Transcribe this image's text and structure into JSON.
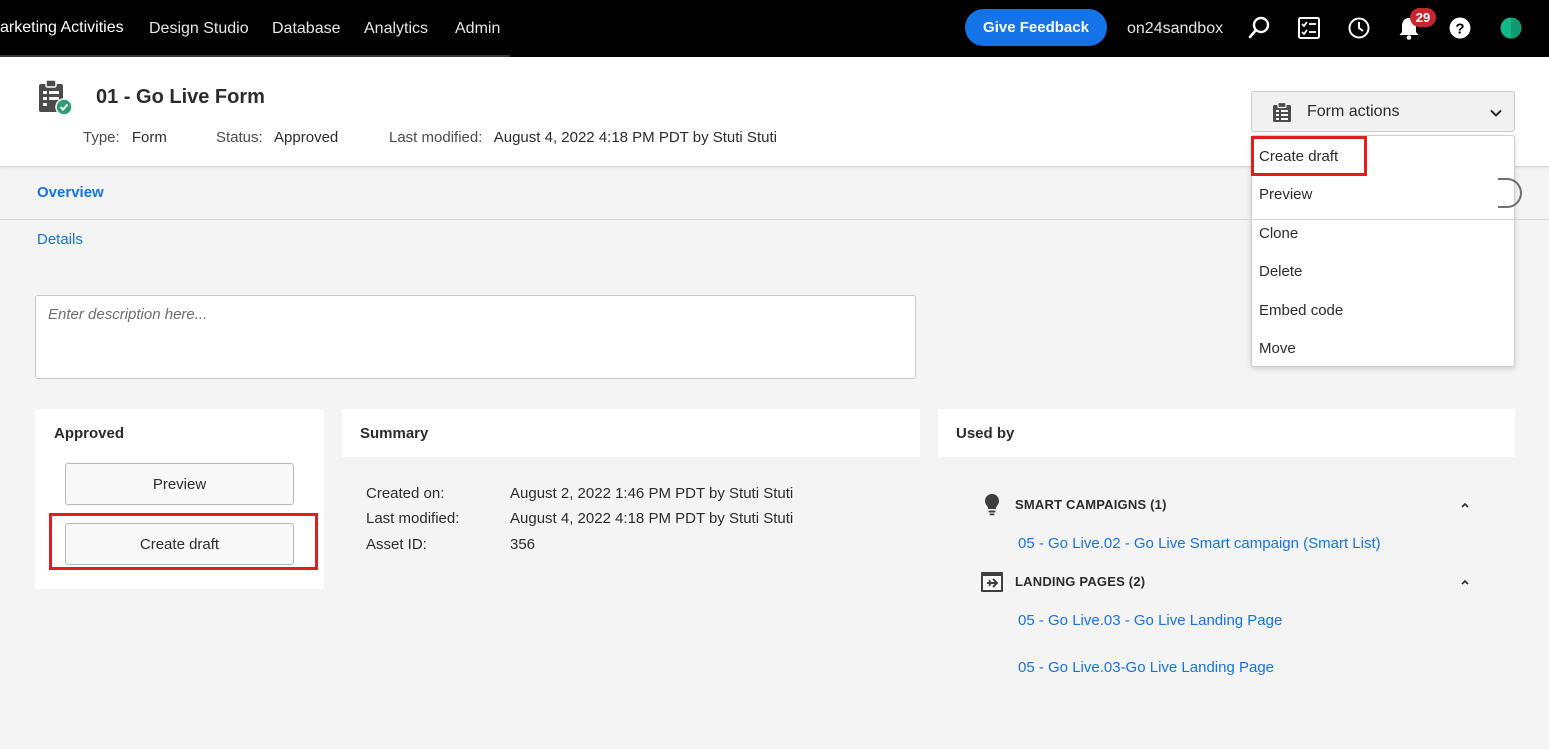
{
  "topnav": {
    "items": [
      {
        "label": "arketing Activities",
        "active": true
      },
      {
        "label": "Design Studio",
        "active": false
      },
      {
        "label": "Database",
        "active": false
      },
      {
        "label": "Analytics",
        "active": false
      },
      {
        "label": "Admin",
        "active": false
      }
    ],
    "feedback_label": "Give Feedback",
    "sandbox": "on24sandbox",
    "notification_count": "29",
    "icons": [
      "search-icon",
      "tasks-icon",
      "history-icon",
      "bell-icon",
      "help-icon",
      "user-avatar-icon"
    ]
  },
  "header": {
    "title": "01 - Go Live Form",
    "type_label": "Type:",
    "type_value": "Form",
    "status_label": "Status:",
    "status_value": "Approved",
    "modified_label": "Last modified:",
    "modified_value": "August 4, 2022 4:18 PM PDT by Stuti Stuti",
    "actions_label": "Form actions"
  },
  "actions_menu": {
    "items": [
      "Create draft",
      "Preview",
      "Clone",
      "Delete",
      "Embed code",
      "Move"
    ]
  },
  "tabs": {
    "overview": "Overview",
    "details": "Details"
  },
  "description": {
    "placeholder": "Enter description here..."
  },
  "approved_card": {
    "title": "Approved",
    "preview_label": "Preview",
    "create_draft_label": "Create draft"
  },
  "summary_card": {
    "title": "Summary",
    "rows": [
      {
        "label": "Created on:",
        "value": "August 2, 2022 1:46 PM PDT by Stuti Stuti"
      },
      {
        "label": "Last modified:",
        "value": "August 4, 2022 4:18 PM PDT by Stuti Stuti"
      },
      {
        "label": "Asset ID:",
        "value": "356"
      }
    ]
  },
  "used_by_card": {
    "title": "Used by",
    "sections": [
      {
        "title": "SMART CAMPAIGNS (1)",
        "icon": "lightbulb-icon",
        "links": [
          "05 - Go Live.02 - Go Live Smart campaign (Smart List)"
        ]
      },
      {
        "title": "LANDING PAGES (2)",
        "icon": "landing-page-icon",
        "links": [
          "05 - Go Live.03 - Go Live Landing Page",
          "05 - Go Live.03-Go Live Landing Page"
        ]
      }
    ]
  },
  "colors": {
    "accent": "#1473e6",
    "highlight": "#e31c1c",
    "badge": "#c9252d",
    "avatar": "#12b886"
  }
}
